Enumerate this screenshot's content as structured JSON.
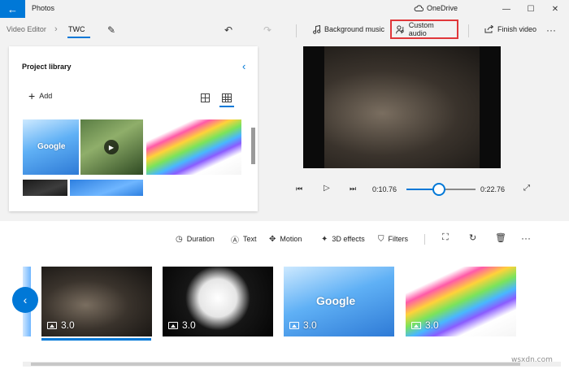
{
  "window": {
    "app_title": "Photos",
    "back_glyph": "←",
    "cloud_label": "OneDrive",
    "minimize_glyph": "—",
    "maximize_glyph": "☐",
    "close_glyph": "✕"
  },
  "toolbar": {
    "breadcrumb_root": "Video Editor",
    "breadcrumb_sep": "›",
    "breadcrumb_project": "TWC",
    "rename_glyph": "✎",
    "undo_glyph": "↶",
    "redo_glyph": "↷",
    "background_music": "Background music",
    "custom_audio": "Custom audio",
    "finish_video": "Finish video",
    "more_glyph": "···",
    "highlight_color": "#e0373a"
  },
  "library": {
    "title": "Project library",
    "collapse_glyph": "‹",
    "add_label": "Add",
    "add_glyph": "+",
    "thumbnails": [
      {
        "kind": "google",
        "label": "Google"
      },
      {
        "kind": "forest",
        "play": "▶"
      },
      {
        "kind": "rainbow"
      },
      {
        "kind": "dark"
      },
      {
        "kind": "blue"
      }
    ]
  },
  "player": {
    "prev_glyph": "⏮",
    "play_glyph": "▷",
    "next_glyph": "⏭",
    "current_time": "0:10.76",
    "total_time": "0:22.76",
    "progress": 0.47,
    "fullscreen_glyph": "⤢"
  },
  "storyboard": {
    "tools": {
      "duration": "Duration",
      "text": "Text",
      "motion": "Motion",
      "effects3d": "3D effects",
      "filters": "Filters"
    },
    "tool_glyphs": {
      "duration": "◷",
      "text": "Ⓐ",
      "motion": "✥",
      "effects3d": "✦",
      "filters": "⛉",
      "crop": "⛶",
      "rotate": "↻",
      "delete": "🗑",
      "more": "···"
    },
    "cards": [
      {
        "kind": "drum",
        "duration": "3.0"
      },
      {
        "kind": "rabbit",
        "duration": "3.0"
      },
      {
        "kind": "google",
        "duration": "3.0",
        "label": "Google"
      },
      {
        "kind": "rainbow",
        "duration": "3.0"
      }
    ],
    "scroll_left_glyph": "‹"
  },
  "footer": {
    "watermark": "wsxdn.com"
  },
  "colors": {
    "accent": "#0078d7",
    "chrome": "#f2f2f2"
  }
}
